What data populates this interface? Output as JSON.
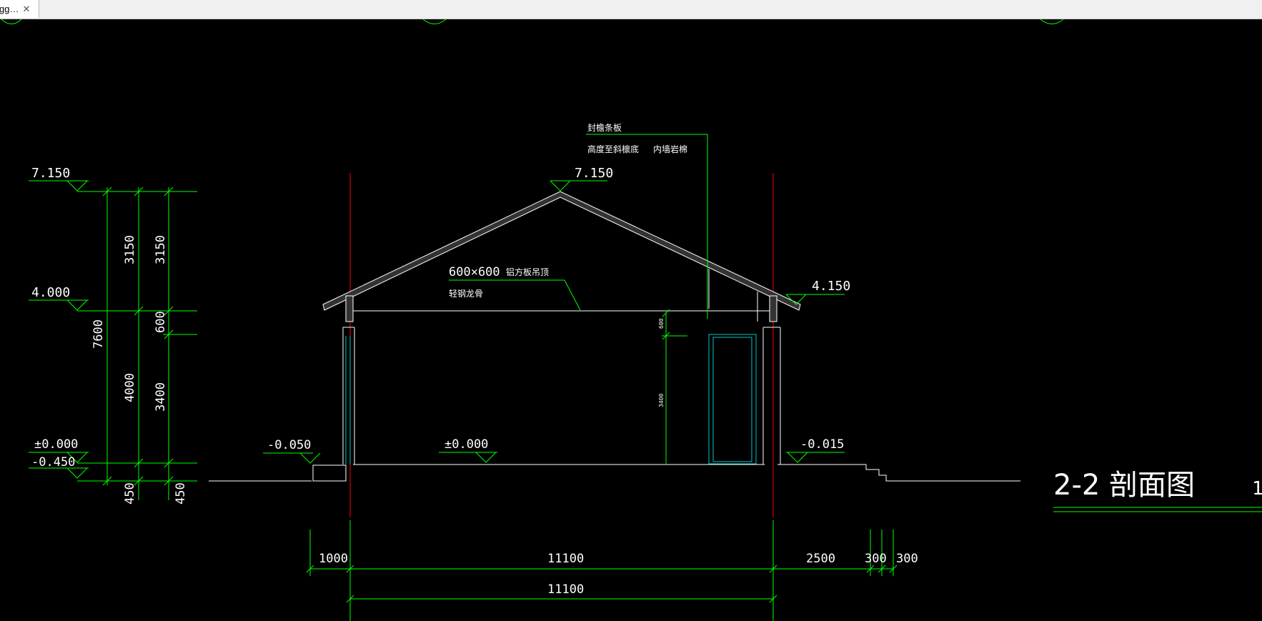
{
  "tab": {
    "label": "gg…",
    "close": "✕"
  },
  "drawing": {
    "title": "2-2 剖面图",
    "title_suffix": "1",
    "elevations": {
      "left_top": "7.150",
      "left_eave": "4.000",
      "left_zero": "±0.000",
      "left_ground": "-0.450",
      "ridge": "7.150",
      "right_eave": "4.150",
      "outdoor_left": "-0.050",
      "indoor": "±0.000",
      "outdoor_right": "-0.015"
    },
    "vertical_dims": {
      "total": "7600",
      "col1_upper": "3150",
      "col1_lower": "4000",
      "col1_base": "450",
      "col2_upper": "3150",
      "col2_mid": "600",
      "col2_lower": "3400",
      "col2_base": "450",
      "inner_600": "600",
      "inner_3400": "3400"
    },
    "horizontal_dims": {
      "d1": "1000",
      "d2": "11100",
      "d3": "2500",
      "d4": "300",
      "d5": "300",
      "overall": "11100"
    },
    "annotations": {
      "ceiling_size": "600×600",
      "ceiling_material": "铝方板吊顶",
      "ceiling_keel": "轻钢龙骨",
      "roof_note_1": "封檐条板",
      "roof_note_2": "高度至斜檩底",
      "roof_note_3": "内墙岩棉"
    },
    "colors": {
      "background": "#000000",
      "dim_green": "#00ff00",
      "axis_red": "#ff0000",
      "door_cyan": "#00c8c8",
      "line_white": "#ffffff"
    }
  }
}
